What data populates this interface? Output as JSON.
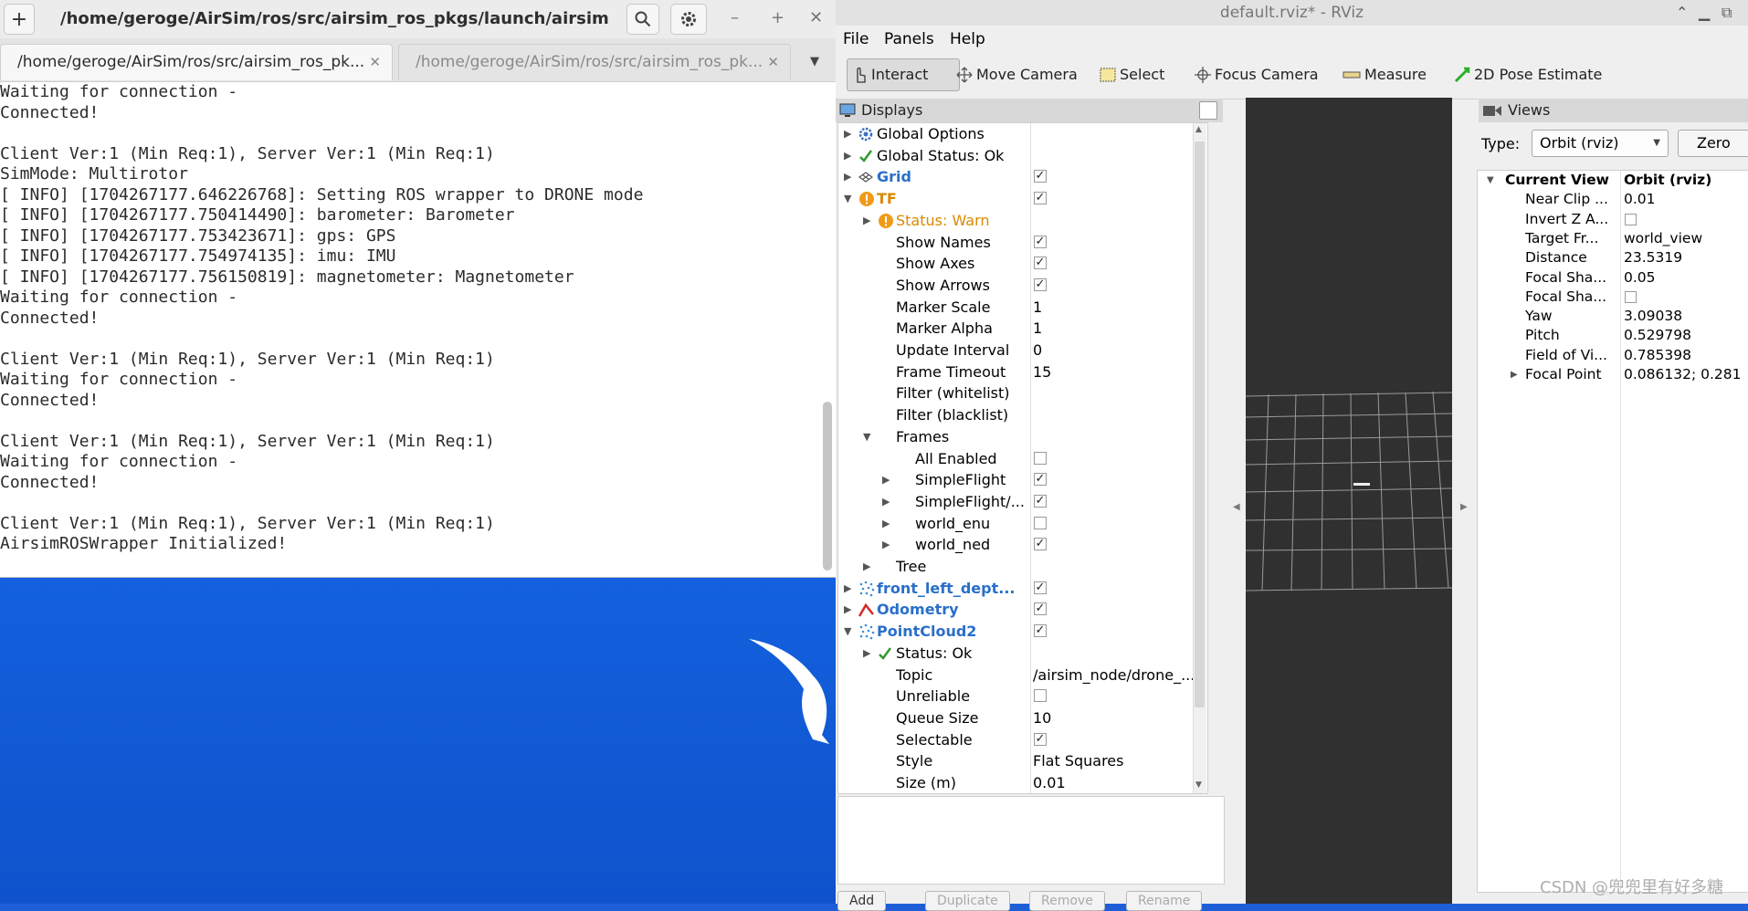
{
  "terminal": {
    "title": "/home/geroge/AirSim/ros/src/airsim_ros_pkgs/launch/airsim_...",
    "tabs": [
      {
        "label": "/home/geroge/AirSim/ros/src/airsim_ros_pk...",
        "active": true
      },
      {
        "label": "/home/geroge/AirSim/ros/src/airsim_ros_pk...",
        "active": false
      }
    ],
    "lines": [
      "Waiting for connection -",
      "Connected!",
      "",
      "Client Ver:1 (Min Req:1), Server Ver:1 (Min Req:1)",
      "SimMode: Multirotor",
      "[ INFO] [1704267177.646226768]: Setting ROS wrapper to DRONE mode",
      "[ INFO] [1704267177.750414490]: barometer: Barometer",
      "[ INFO] [1704267177.753423671]: gps: GPS",
      "[ INFO] [1704267177.754974135]: imu: IMU",
      "[ INFO] [1704267177.756150819]: magnetometer: Magnetometer",
      "Waiting for connection -",
      "Connected!",
      "",
      "Client Ver:1 (Min Req:1), Server Ver:1 (Min Req:1)",
      "Waiting for connection -",
      "Connected!",
      "",
      "Client Ver:1 (Min Req:1), Server Ver:1 (Min Req:1)",
      "Waiting for connection -",
      "Connected!",
      "",
      "Client Ver:1 (Min Req:1), Server Ver:1 (Min Req:1)",
      "AirsimROSWrapper Initialized!"
    ]
  },
  "rviz": {
    "window_title": "default.rviz* - RViz",
    "menu": [
      "File",
      "Panels",
      "Help"
    ],
    "tools": [
      "Interact",
      "Move Camera",
      "Select",
      "Focus Camera",
      "Measure",
      "2D Pose Estimate"
    ],
    "displays_panel_title": "Displays",
    "displays": [
      {
        "depth": 0,
        "arrow": "right",
        "icon": "gear-icon",
        "name": "Global Options",
        "style": "normal",
        "value": "",
        "check": null
      },
      {
        "depth": 0,
        "arrow": "right",
        "icon": "check-icon",
        "name": "Global Status: Ok",
        "style": "normal",
        "value": "",
        "check": null
      },
      {
        "depth": 0,
        "arrow": "right",
        "icon": "grid-icon",
        "name": "Grid",
        "style": "blue",
        "value": "",
        "check": true
      },
      {
        "depth": 0,
        "arrow": "down",
        "icon": "warn-icon",
        "name": "TF",
        "style": "orange",
        "value": "",
        "check": true
      },
      {
        "depth": 1,
        "arrow": "right",
        "icon": "warn-icon",
        "name": "Status: Warn",
        "style": "orange-normal",
        "value": "",
        "check": null
      },
      {
        "depth": 1,
        "arrow": "",
        "icon": "",
        "name": "Show Names",
        "style": "normal",
        "value": "",
        "check": true
      },
      {
        "depth": 1,
        "arrow": "",
        "icon": "",
        "name": "Show Axes",
        "style": "normal",
        "value": "",
        "check": true
      },
      {
        "depth": 1,
        "arrow": "",
        "icon": "",
        "name": "Show Arrows",
        "style": "normal",
        "value": "",
        "check": true
      },
      {
        "depth": 1,
        "arrow": "",
        "icon": "",
        "name": "Marker Scale",
        "style": "normal",
        "value": "1",
        "check": null
      },
      {
        "depth": 1,
        "arrow": "",
        "icon": "",
        "name": "Marker Alpha",
        "style": "normal",
        "value": "1",
        "check": null
      },
      {
        "depth": 1,
        "arrow": "",
        "icon": "",
        "name": "Update Interval",
        "style": "normal",
        "value": "0",
        "check": null
      },
      {
        "depth": 1,
        "arrow": "",
        "icon": "",
        "name": "Frame Timeout",
        "style": "normal",
        "value": "15",
        "check": null
      },
      {
        "depth": 1,
        "arrow": "",
        "icon": "",
        "name": "Filter (whitelist)",
        "style": "normal",
        "value": "",
        "check": null
      },
      {
        "depth": 1,
        "arrow": "",
        "icon": "",
        "name": "Filter (blacklist)",
        "style": "normal",
        "value": "",
        "check": null
      },
      {
        "depth": 1,
        "arrow": "down",
        "icon": "",
        "name": "Frames",
        "style": "normal",
        "value": "",
        "check": null
      },
      {
        "depth": 2,
        "arrow": "",
        "icon": "",
        "name": "All Enabled",
        "style": "normal",
        "value": "",
        "check": false
      },
      {
        "depth": 2,
        "arrow": "right",
        "icon": "",
        "name": "SimpleFlight",
        "style": "normal",
        "value": "",
        "check": true
      },
      {
        "depth": 2,
        "arrow": "right",
        "icon": "",
        "name": "SimpleFlight/...",
        "style": "normal",
        "value": "",
        "check": true
      },
      {
        "depth": 2,
        "arrow": "right",
        "icon": "",
        "name": "world_enu",
        "style": "normal",
        "value": "",
        "check": false
      },
      {
        "depth": 2,
        "arrow": "right",
        "icon": "",
        "name": "world_ned",
        "style": "normal",
        "value": "",
        "check": true
      },
      {
        "depth": 1,
        "arrow": "right",
        "icon": "",
        "name": "Tree",
        "style": "normal",
        "value": "",
        "check": null
      },
      {
        "depth": 0,
        "arrow": "right",
        "icon": "points-icon",
        "name": "front_left_dept...",
        "style": "blue",
        "value": "",
        "check": true
      },
      {
        "depth": 0,
        "arrow": "right",
        "icon": "odometry-icon",
        "name": "Odometry",
        "style": "blue",
        "value": "",
        "check": true
      },
      {
        "depth": 0,
        "arrow": "down",
        "icon": "points-icon",
        "name": "PointCloud2",
        "style": "blue",
        "value": "",
        "check": true
      },
      {
        "depth": 1,
        "arrow": "right",
        "icon": "check-icon",
        "name": "Status: Ok",
        "style": "normal",
        "value": "",
        "check": null
      },
      {
        "depth": 1,
        "arrow": "",
        "icon": "",
        "name": "Topic",
        "style": "normal",
        "value": "/airsim_node/drone_...",
        "check": null
      },
      {
        "depth": 1,
        "arrow": "",
        "icon": "",
        "name": "Unreliable",
        "style": "normal",
        "value": "",
        "check": false
      },
      {
        "depth": 1,
        "arrow": "",
        "icon": "",
        "name": "Queue Size",
        "style": "normal",
        "value": "10",
        "check": null
      },
      {
        "depth": 1,
        "arrow": "",
        "icon": "",
        "name": "Selectable",
        "style": "normal",
        "value": "",
        "check": true
      },
      {
        "depth": 1,
        "arrow": "",
        "icon": "",
        "name": "Style",
        "style": "normal",
        "value": "Flat Squares",
        "check": null
      },
      {
        "depth": 1,
        "arrow": "",
        "icon": "",
        "name": "Size (m)",
        "style": "normal",
        "value": "0.01",
        "check": null
      }
    ],
    "bottom_buttons": [
      "Add",
      "Duplicate",
      "Remove",
      "Rename"
    ],
    "views_panel_title": "Views",
    "views_type_label": "Type:",
    "views_type_value": "Orbit (rviz)",
    "views_zero_button": "Zero",
    "views_rows": [
      {
        "name": "Current View",
        "value": "Orbit (rviz)",
        "header": true,
        "arrow": "down",
        "check": null
      },
      {
        "name": "Near Clip ...",
        "value": "0.01",
        "header": false,
        "arrow": "",
        "check": null
      },
      {
        "name": "Invert Z A...",
        "value": "",
        "header": false,
        "arrow": "",
        "check": false
      },
      {
        "name": "Target Fr...",
        "value": "world_view",
        "header": false,
        "arrow": "",
        "check": null
      },
      {
        "name": "Distance",
        "value": "23.5319",
        "header": false,
        "arrow": "",
        "check": null
      },
      {
        "name": "Focal Sha...",
        "value": "0.05",
        "header": false,
        "arrow": "",
        "check": null
      },
      {
        "name": "Focal Sha...",
        "value": "",
        "header": false,
        "arrow": "",
        "check": false
      },
      {
        "name": "Yaw",
        "value": "3.09038",
        "header": false,
        "arrow": "",
        "check": null
      },
      {
        "name": "Pitch",
        "value": "0.529798",
        "header": false,
        "arrow": "",
        "check": null
      },
      {
        "name": "Field of Vi...",
        "value": "0.785398",
        "header": false,
        "arrow": "",
        "check": null
      },
      {
        "name": "Focal Point",
        "value": "0.086132; 0.281",
        "header": false,
        "arrow": "right",
        "check": null
      }
    ]
  },
  "watermark": "CSDN @兜兜里有好多糖",
  "colors": {
    "blue_name": "#2a6fc9",
    "orange_name": "#d88a00",
    "desktop": "#1462e0"
  }
}
